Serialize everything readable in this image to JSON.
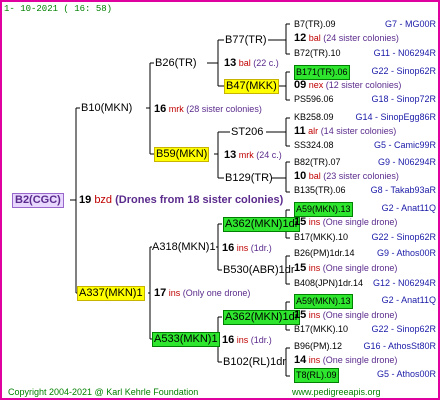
{
  "header": {
    "date": "1- 10-2021 ( 16: 58)"
  },
  "root": {
    "label": "B2(CGC)",
    "num": "19",
    "code": "bzd",
    "note": "(Drones from 18 sister colonies)"
  },
  "g1": [
    {
      "label": "B10(MKN)",
      "num": "16",
      "code": "mrk",
      "note": "(28 sister colonies)"
    },
    {
      "label": "A337(MKN)1",
      "num": "17",
      "code": "ins",
      "note": "(Only one drone)"
    }
  ],
  "g2": [
    {
      "label": "B26(TR)"
    },
    {
      "label": "B59(MKN)",
      "num": "13",
      "code": "mrk",
      "note": "(24 c.)"
    },
    {
      "label": "A318(MKN)1",
      "num": "16",
      "code": "ins",
      "note": "(1dr.)"
    },
    {
      "label": "A533(MKN)1",
      "num": "16",
      "code": "ins",
      "note": "(1dr.)"
    }
  ],
  "g3": [
    {
      "label": "B77(TR)"
    },
    {
      "label": "B47(MKK)",
      "num": "13",
      "code": "bal",
      "note": "(22 c.)"
    },
    {
      "label": "ST206"
    },
    {
      "label": "B129(TR)"
    },
    {
      "label": "A362(MKN)1dr"
    },
    {
      "label": "B530(ABR)1dr"
    },
    {
      "label": "A362(MKN)1dr"
    },
    {
      "label": "B102(RL)1dr"
    }
  ],
  "g4": [
    {
      "label": "B7(TR).09",
      "right": "G7 - MG00R"
    },
    {
      "label": "12 bal (24 sister colonies)",
      "num": "12",
      "code": "bal",
      "note": "(24 sister colonies)"
    },
    {
      "label": "B72(TR).10",
      "right": "G11 - N06294R"
    },
    {
      "label": "B171(TR).06",
      "right": "G22 - Sinop62R"
    },
    {
      "label": "09 nex",
      "num": "09",
      "code": "nex",
      "note": "(12 sister colonies)"
    },
    {
      "label": "PS596.06",
      "right": "G18 - Sinop72R"
    },
    {
      "label": "KB258.09",
      "right": "G14 - SinopEgg86R"
    },
    {
      "label": "11 alr",
      "num": "11",
      "code": "alr",
      "note": "(14 sister colonies)"
    },
    {
      "label": "SS324.08",
      "right": "G5 - Camic99R"
    },
    {
      "label": "B82(TR).07",
      "right": "G9 - N06294R"
    },
    {
      "label": "10 bal",
      "num": "10",
      "code": "bal",
      "note": "(23 sister colonies)"
    },
    {
      "label": "B135(TR).06",
      "right": "G8 - Takab93aR"
    },
    {
      "label": "A59(MKN).13",
      "right": "G2 - Anat11Q"
    },
    {
      "label": "15 ins",
      "num": "15",
      "code": "ins",
      "note": "(One single drone)"
    },
    {
      "label": "B17(MKK).10",
      "right": "G22 - Sinop62R"
    },
    {
      "label": "B26(PM)1dr.14",
      "right": "G9 - Athos00R"
    },
    {
      "label": "15 ins",
      "num": "15",
      "code": "ins",
      "note": "(One single drone)"
    },
    {
      "label": "B408(JPN)1dr.14",
      "right": "G12 - N06294R"
    },
    {
      "label": "A59(MKN).13",
      "right": "G2 - Anat11Q"
    },
    {
      "label": "15 ins",
      "num": "15",
      "code": "ins",
      "note": "(One single drone)"
    },
    {
      "label": "B17(MKK).10",
      "right": "G22 - Sinop62R"
    },
    {
      "label": "B96(PM).12",
      "right": "G16 - AthosSt80R"
    },
    {
      "label": "14 ins",
      "num": "14",
      "code": "ins",
      "note": "(One single drone)"
    },
    {
      "label": "T8(RL).09",
      "right": "G5 - Athos00R"
    }
  ],
  "footer": {
    "copyright": "Copyright 2004-2021 @ Karl Kehrle Foundation",
    "url": "www.pedigreeapis.org"
  }
}
